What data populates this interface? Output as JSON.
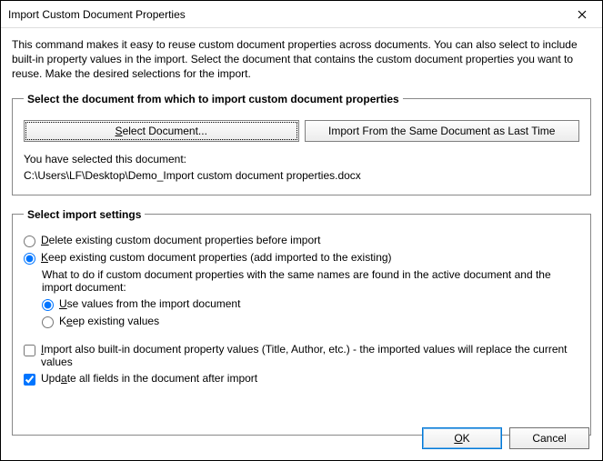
{
  "window": {
    "title": "Import Custom Document Properties"
  },
  "intro": "This command makes it easy to reuse custom document properties across documents. You can also select to include built-in property values in the import. Select the document that contains the custom document properties you want to reuse. Make the desired selections for the import.",
  "group1": {
    "legend": "Select the document from which to import custom document properties",
    "select_document_label": "Select Document...",
    "import_same_label": "Import From the Same Document as Last Time",
    "selected_prefix": "You have selected this document:",
    "selected_path": "C:\\Users\\LF\\Desktop\\Demo_Import custom document properties.docx"
  },
  "group2": {
    "legend": "Select import settings",
    "opt_delete": {
      "label_pre": "",
      "accel": "D",
      "label_post": "elete existing custom document properties before import",
      "checked": false
    },
    "opt_keep": {
      "label_pre": "",
      "accel": "K",
      "label_post": "eep existing custom document properties (add imported to the existing)",
      "checked": true
    },
    "sub_question": "What to do if custom document properties with the same names are found in the active document and the import document:",
    "sub_use": {
      "label_pre": "",
      "accel": "U",
      "label_post": "se values from the import document",
      "checked": true
    },
    "sub_keepv": {
      "label_pre": "K",
      "accel": "e",
      "label_post": "ep existing values",
      "checked": false
    },
    "chk_builtin": {
      "label_pre": "",
      "accel": "I",
      "label_post": "mport also built-in document property values (Title, Author, etc.) - the imported values will replace the current values",
      "checked": false
    },
    "chk_update": {
      "label_pre": "Upd",
      "accel": "a",
      "label_post": "te all fields in the document after import",
      "checked": true
    }
  },
  "buttons": {
    "ok_pre": "",
    "ok_accel": "O",
    "ok_post": "K",
    "cancel": "Cancel"
  }
}
